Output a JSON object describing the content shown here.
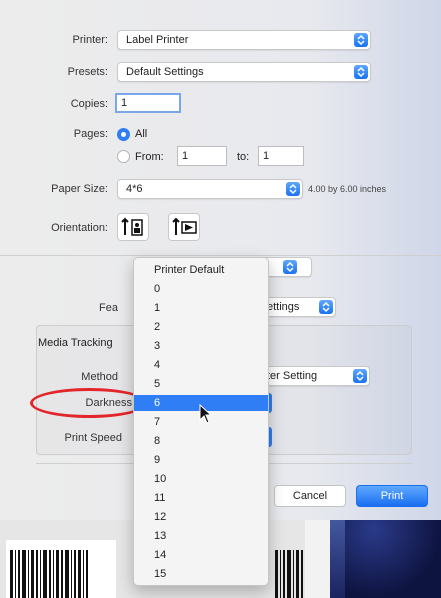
{
  "printer": {
    "label": "Printer:",
    "value": "Label Printer"
  },
  "presets": {
    "label": "Presets:",
    "value": "Default Settings"
  },
  "copies": {
    "label": "Copies:",
    "value": "1"
  },
  "pages": {
    "label": "Pages:",
    "all_label": "All",
    "from_label": "From:",
    "from_value": "1",
    "to_label": "to:",
    "to_value": "1"
  },
  "paper_size": {
    "label": "Paper Size:",
    "value": "4*6",
    "dimensions": "4.00 by 6.00 inches"
  },
  "orientation": {
    "label": "Orientation:"
  },
  "section": {
    "features_label_partial": "Fea",
    "features_value_partial": "ettings"
  },
  "media": {
    "tracking_label_partial": "Media Tracking",
    "method_label_partial": "Method",
    "method_value_partial": "ter Setting",
    "darkness_label": "Darkness",
    "print_speed_label": "Print Speed"
  },
  "darkness_menu": {
    "items": [
      "Printer Default",
      "0",
      "1",
      "2",
      "3",
      "4",
      "5",
      "6",
      "7",
      "8",
      "9",
      "10",
      "11",
      "12",
      "13",
      "14",
      "15"
    ],
    "selected": "6"
  },
  "buttons": {
    "cancel": "Cancel",
    "print": "Print"
  },
  "colors": {
    "accent": "#2f7ef5",
    "annotation": "#e3262b"
  },
  "icons": [
    "chevron-updown-icon",
    "portrait-orientation-icon",
    "landscape-orientation-icon",
    "pointer-cursor-icon"
  ]
}
